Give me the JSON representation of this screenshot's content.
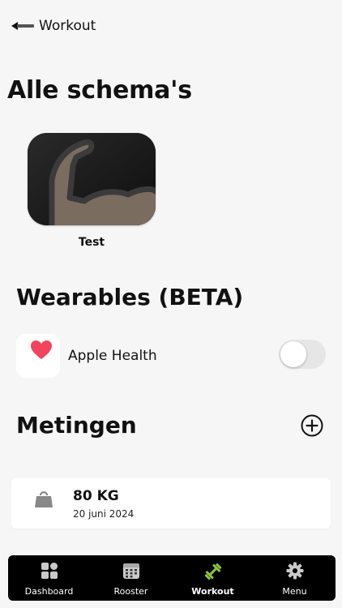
{
  "header": {
    "back_label": "Workout"
  },
  "schemas": {
    "title": "Alle schema's",
    "items": [
      {
        "name": "Test",
        "icon": "flexed-bicep-icon"
      }
    ]
  },
  "wearables": {
    "title": "Wearables (BETA)",
    "items": [
      {
        "name": "Apple Health",
        "icon": "heart-icon",
        "enabled": false
      }
    ]
  },
  "metingen": {
    "title": "Metingen",
    "add_icon": "plus-circle-icon",
    "items": [
      {
        "value": "80 KG",
        "date": "20 juni 2024",
        "icon": "weight-icon"
      }
    ]
  },
  "tabbar": {
    "active": "Workout",
    "items": [
      {
        "label": "Dashboard",
        "icon": "dashboard-icon"
      },
      {
        "label": "Rooster",
        "icon": "calendar-icon"
      },
      {
        "label": "Workout",
        "icon": "dumbbell-icon"
      },
      {
        "label": "Menu",
        "icon": "gear-icon"
      }
    ]
  },
  "colors": {
    "background": "#f6f6f6",
    "heart": "#f2455d",
    "active_tab_icon": "#8cc63f",
    "tabbar": "#000000"
  }
}
